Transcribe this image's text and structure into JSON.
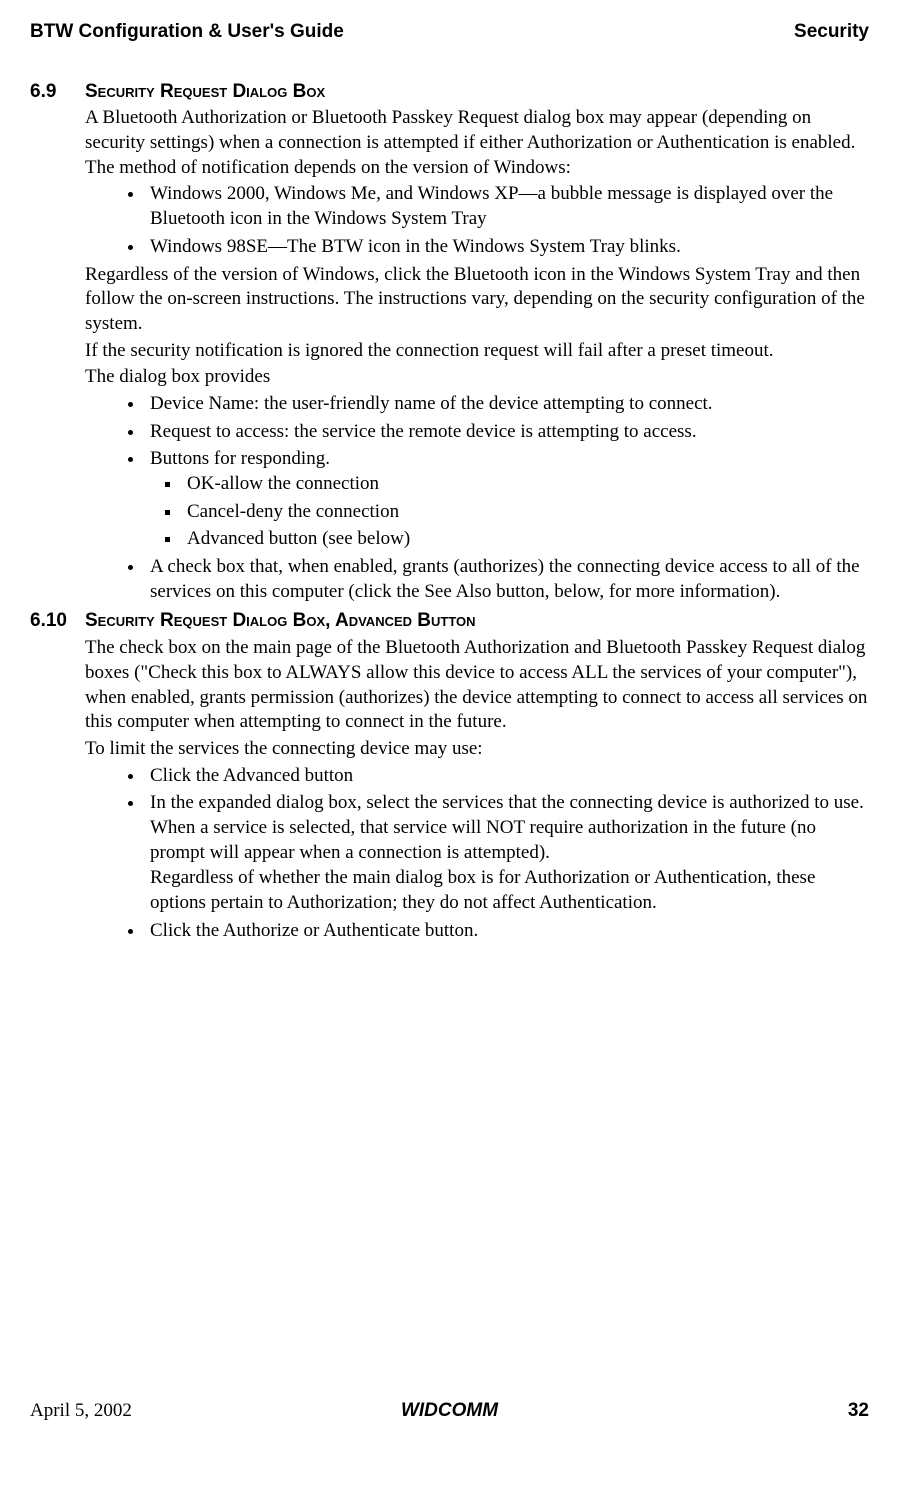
{
  "header": {
    "left": "BTW Configuration & User's Guide",
    "right": "Security"
  },
  "sections": [
    {
      "number": "6.9",
      "title": "Security Request Dialog Box",
      "paras": [
        "A Bluetooth Authorization or Bluetooth Passkey Request dialog box may appear (depending on security settings) when a connection is attempted if either Authorization or Authentication is enabled. The method of notification depends on the version of Windows:"
      ],
      "list1": [
        "Windows 2000, Windows Me, and Windows XP—a bubble message is displayed over the Bluetooth icon in the Windows System Tray",
        "Windows 98SE—The BTW icon in the Windows System Tray blinks."
      ],
      "paras2": [
        "Regardless of the version of Windows, click the Bluetooth icon in the Windows System Tray and then follow the on-screen instructions. The instructions vary, depending on the security configuration of the system.",
        "If the security notification is ignored the connection request will fail after a preset timeout.",
        "The dialog box provides"
      ],
      "list2": [
        "Device Name: the user-friendly name of the device attempting to connect.",
        "Request to access: the service the remote device is attempting to access.",
        "Buttons for responding."
      ],
      "sublist": [
        "OK-allow the connection",
        "Cancel-deny the connection",
        "Advanced button (see below)"
      ],
      "list3": [
        "A check box that, when enabled, grants (authorizes) the connecting device access to all of the services on this computer (click the See Also button, below, for more information)."
      ]
    },
    {
      "number": "6.10",
      "title": "Security Request Dialog Box, Advanced Button",
      "paras": [
        "The check box on the main page of the Bluetooth Authorization and Bluetooth Passkey Request dialog boxes (\"Check this box to ALWAYS allow this device to access ALL the services of your computer\"), when enabled, grants permission (authorizes) the device attempting to connect to access all services on this computer when attempting to connect in the future.",
        "To limit the services the connecting device may use:"
      ],
      "list1": [
        "Click the Advanced button"
      ],
      "list1b_main": "In the expanded dialog box, select the services that the connecting device is authorized to use. When a service is selected, that service will NOT require authorization in the future (no prompt will appear when a connection is attempted).",
      "list1b_sub": "Regardless of whether the main dialog box is for Authorization or Authentication, these options pertain to Authorization; they do not affect Authentication.",
      "list1c": [
        "Click the Authorize or Authenticate button."
      ]
    }
  ],
  "footer": {
    "date": "April 5, 2002",
    "center": "WIDCOMM",
    "page": "32"
  }
}
